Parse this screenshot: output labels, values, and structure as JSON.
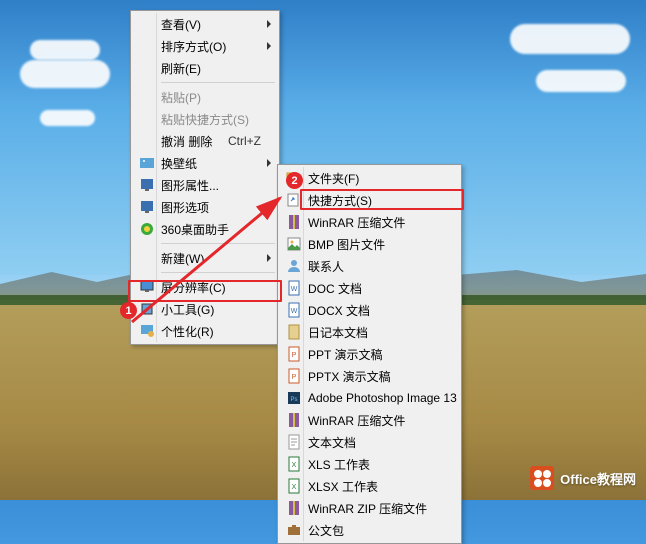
{
  "menu1": {
    "items": [
      {
        "label": "查看(V)",
        "icon": null,
        "submenu": true
      },
      {
        "label": "排序方式(O)",
        "icon": null,
        "submenu": true
      },
      {
        "label": "刷新(E)",
        "icon": null,
        "submenu": false
      },
      {
        "sep": true
      },
      {
        "label": "粘贴(P)",
        "icon": null,
        "disabled": true
      },
      {
        "label": "粘贴快捷方式(S)",
        "icon": null,
        "disabled": true
      },
      {
        "label": "撤消 删除",
        "shortcut": "Ctrl+Z",
        "icon": null
      },
      {
        "label": "换壁纸",
        "icon": "wallpaper",
        "submenu": true
      },
      {
        "label": "图形属性...",
        "icon": "gfx-props"
      },
      {
        "label": "图形选项",
        "icon": "gfx-opts",
        "submenu": true
      },
      {
        "label": "360桌面助手",
        "icon": "360"
      },
      {
        "sep": true
      },
      {
        "label": "新建(W)",
        "icon": null,
        "submenu": true,
        "highlighted": true
      },
      {
        "sep": true
      },
      {
        "label": "屏分辨率(C)",
        "icon": "monitor"
      },
      {
        "label": "小工具(G)",
        "icon": "gadget"
      },
      {
        "label": "个性化(R)",
        "icon": "personalize"
      }
    ]
  },
  "menu2": {
    "items": [
      {
        "label": "文件夹(F)",
        "icon": "folder"
      },
      {
        "label": "快捷方式(S)",
        "icon": "shortcut",
        "highlighted": true
      },
      {
        "label": "WinRAR 压缩文件",
        "icon": "rar"
      },
      {
        "label": "BMP 图片文件",
        "icon": "bmp"
      },
      {
        "label": "联系人",
        "icon": "contact"
      },
      {
        "label": "DOC 文档",
        "icon": "doc"
      },
      {
        "label": "DOCX 文档",
        "icon": "docx"
      },
      {
        "label": "日记本文档",
        "icon": "journal"
      },
      {
        "label": "PPT 演示文稿",
        "icon": "ppt"
      },
      {
        "label": "PPTX 演示文稿",
        "icon": "pptx"
      },
      {
        "label": "Adobe Photoshop Image 13",
        "icon": "psd"
      },
      {
        "label": "WinRAR 压缩文件",
        "icon": "rar"
      },
      {
        "label": "文本文档",
        "icon": "txt"
      },
      {
        "label": "XLS 工作表",
        "icon": "xls"
      },
      {
        "label": "XLSX 工作表",
        "icon": "xlsx"
      },
      {
        "label": "WinRAR ZIP 压缩文件",
        "icon": "zip"
      },
      {
        "label": "公文包",
        "icon": "briefcase"
      }
    ]
  },
  "annotations": {
    "badge1": "1",
    "badge2": "2"
  },
  "watermark": "Office教程网"
}
